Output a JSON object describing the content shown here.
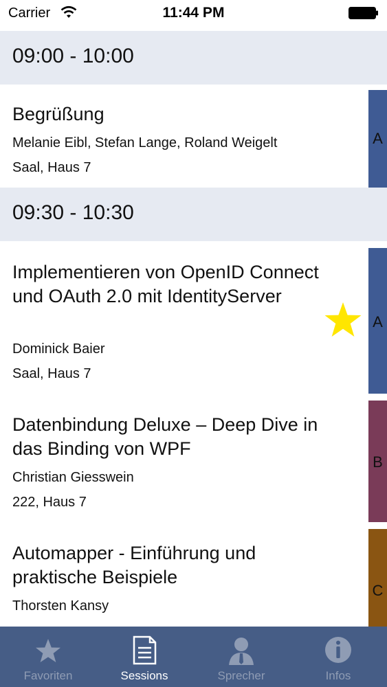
{
  "status_bar": {
    "carrier": "Carrier",
    "time": "11:44 PM"
  },
  "sections": [
    {
      "time_range": "09:00 - 10:00",
      "sessions": [
        {
          "title": "Begrüßung",
          "speaker": "Melanie Eibl, Stefan Lange, Roland Weigelt",
          "room": "Saal, Haus 7",
          "track": "A",
          "track_color": "#3f5b94",
          "favorite": false
        }
      ]
    },
    {
      "time_range": "09:30 - 10:30",
      "sessions": [
        {
          "title": "Implementieren von OpenID Connect und OAuth 2.0 mit IdentityServer",
          "speaker": "Dominick Baier",
          "room": "Saal, Haus 7",
          "track": "A",
          "track_color": "#3f5b94",
          "favorite": true
        },
        {
          "title": "Datenbindung Deluxe – Deep Dive in das Binding von WPF",
          "speaker": "Christian Giesswein",
          "room": "222, Haus 7",
          "track": "B",
          "track_color": "#7a3b58",
          "favorite": false
        },
        {
          "title": "Automapper - Einführung und praktische Beispiele",
          "speaker": "Thorsten Kansy",
          "room": "",
          "track": "C",
          "track_color": "#8a5512",
          "favorite": false
        }
      ]
    }
  ],
  "tab_bar": {
    "tabs": [
      {
        "label": "Favoriten",
        "icon": "star-icon",
        "active": false
      },
      {
        "label": "Sessions",
        "icon": "document-icon",
        "active": true
      },
      {
        "label": "Sprecher",
        "icon": "person-icon",
        "active": false
      },
      {
        "label": "Infos",
        "icon": "info-icon",
        "active": false
      }
    ]
  },
  "colors": {
    "tab_bar_bg": "#465d86",
    "section_header_bg": "#e6eaf2",
    "favorite_star": "#ffe600"
  }
}
